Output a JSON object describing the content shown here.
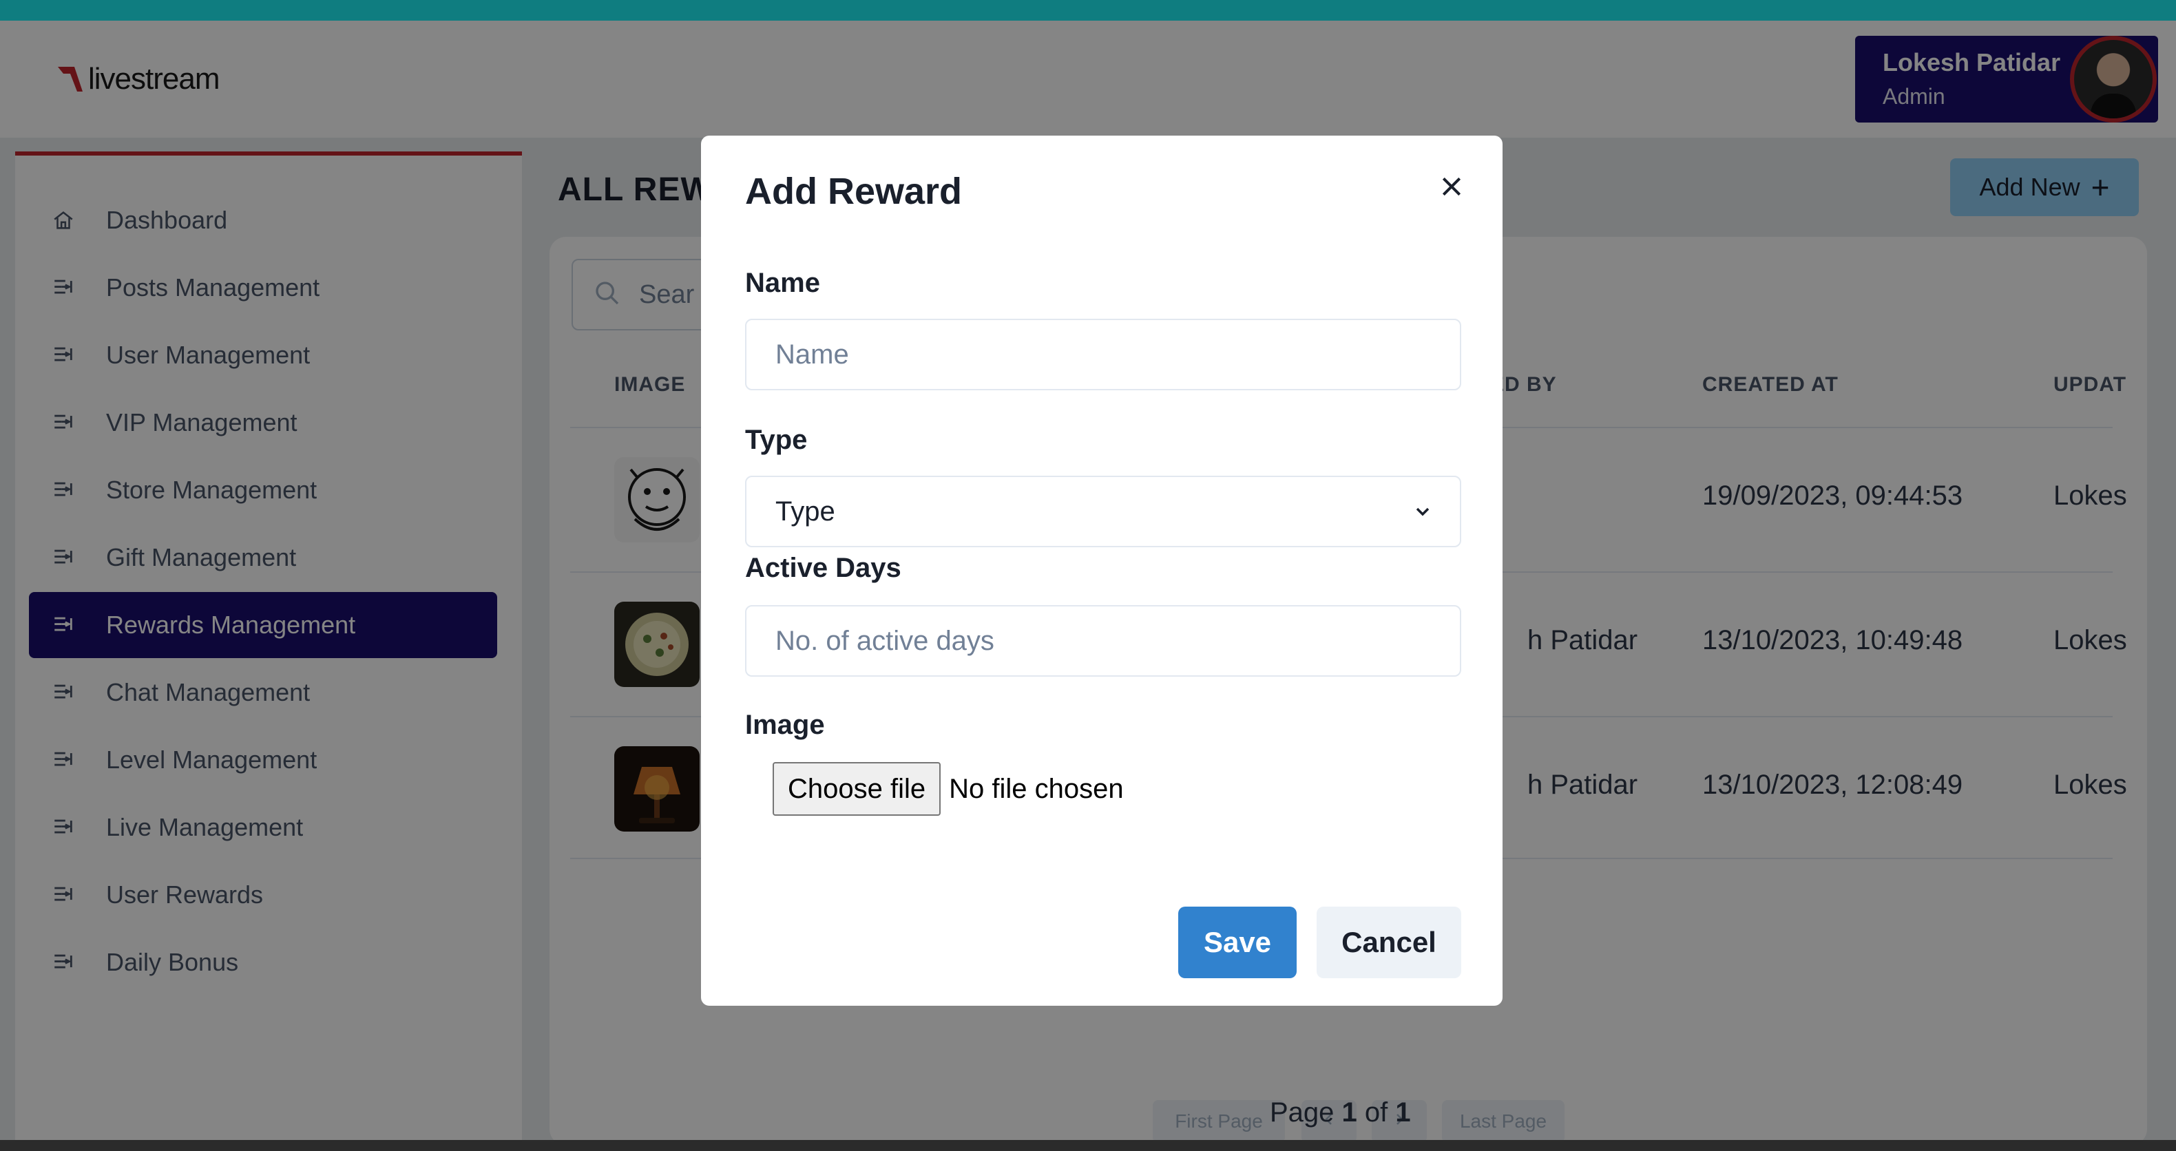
{
  "brand": {
    "logo_text": "livestream",
    "logo_color": "#c0262d"
  },
  "profile": {
    "name": "Lokesh Patidar",
    "role": "Admin"
  },
  "sidebar": {
    "items": [
      {
        "label": "Dashboard",
        "icon": "home-icon",
        "active": false
      },
      {
        "label": "Posts Management",
        "icon": "list-arrow-icon",
        "active": false
      },
      {
        "label": "User Management",
        "icon": "list-arrow-icon",
        "active": false
      },
      {
        "label": "VIP Management",
        "icon": "list-arrow-icon",
        "active": false
      },
      {
        "label": "Store Management",
        "icon": "list-arrow-icon",
        "active": false
      },
      {
        "label": "Gift Management",
        "icon": "list-arrow-icon",
        "active": false
      },
      {
        "label": "Rewards Management",
        "icon": "list-arrow-icon",
        "active": true
      },
      {
        "label": "Chat Management",
        "icon": "list-arrow-icon",
        "active": false
      },
      {
        "label": "Level Management",
        "icon": "list-arrow-icon",
        "active": false
      },
      {
        "label": "Live Management",
        "icon": "list-arrow-icon",
        "active": false
      },
      {
        "label": "User Rewards",
        "icon": "list-arrow-icon",
        "active": false
      },
      {
        "label": "Daily Bonus",
        "icon": "list-arrow-icon",
        "active": false
      }
    ]
  },
  "main": {
    "title": "ALL REW",
    "add_new_label": "Add New",
    "search_placeholder": "Sear",
    "columns": [
      "IMAGE",
      "ED BY",
      "CREATED AT",
      "UPDAT"
    ],
    "rows": [
      {
        "image": "gorilla-sketch",
        "created_by": "",
        "created_at": "19/09/2023, 09:44:53",
        "updated_by": "Lokes"
      },
      {
        "image": "food-bowl",
        "created_by": "h Patidar",
        "created_at": "13/10/2023, 10:49:48",
        "updated_by": "Lokes"
      },
      {
        "image": "lamp",
        "created_by": "h Patidar",
        "created_at": "13/10/2023, 12:08:49",
        "updated_by": "Lokes"
      }
    ],
    "pagination": {
      "first_label": "First Page",
      "last_label": "Last Page",
      "page_word": "Page",
      "current": "1",
      "of_word": "of",
      "total": "1"
    }
  },
  "modal": {
    "title": "Add Reward",
    "name_label": "Name",
    "name_placeholder": "Name",
    "type_label": "Type",
    "type_value": "Type",
    "active_days_label": "Active Days",
    "active_days_placeholder": "No. of active days",
    "image_label": "Image",
    "file_button_label": "Choose file",
    "file_status": "No file chosen",
    "save_label": "Save",
    "cancel_label": "Cancel"
  }
}
